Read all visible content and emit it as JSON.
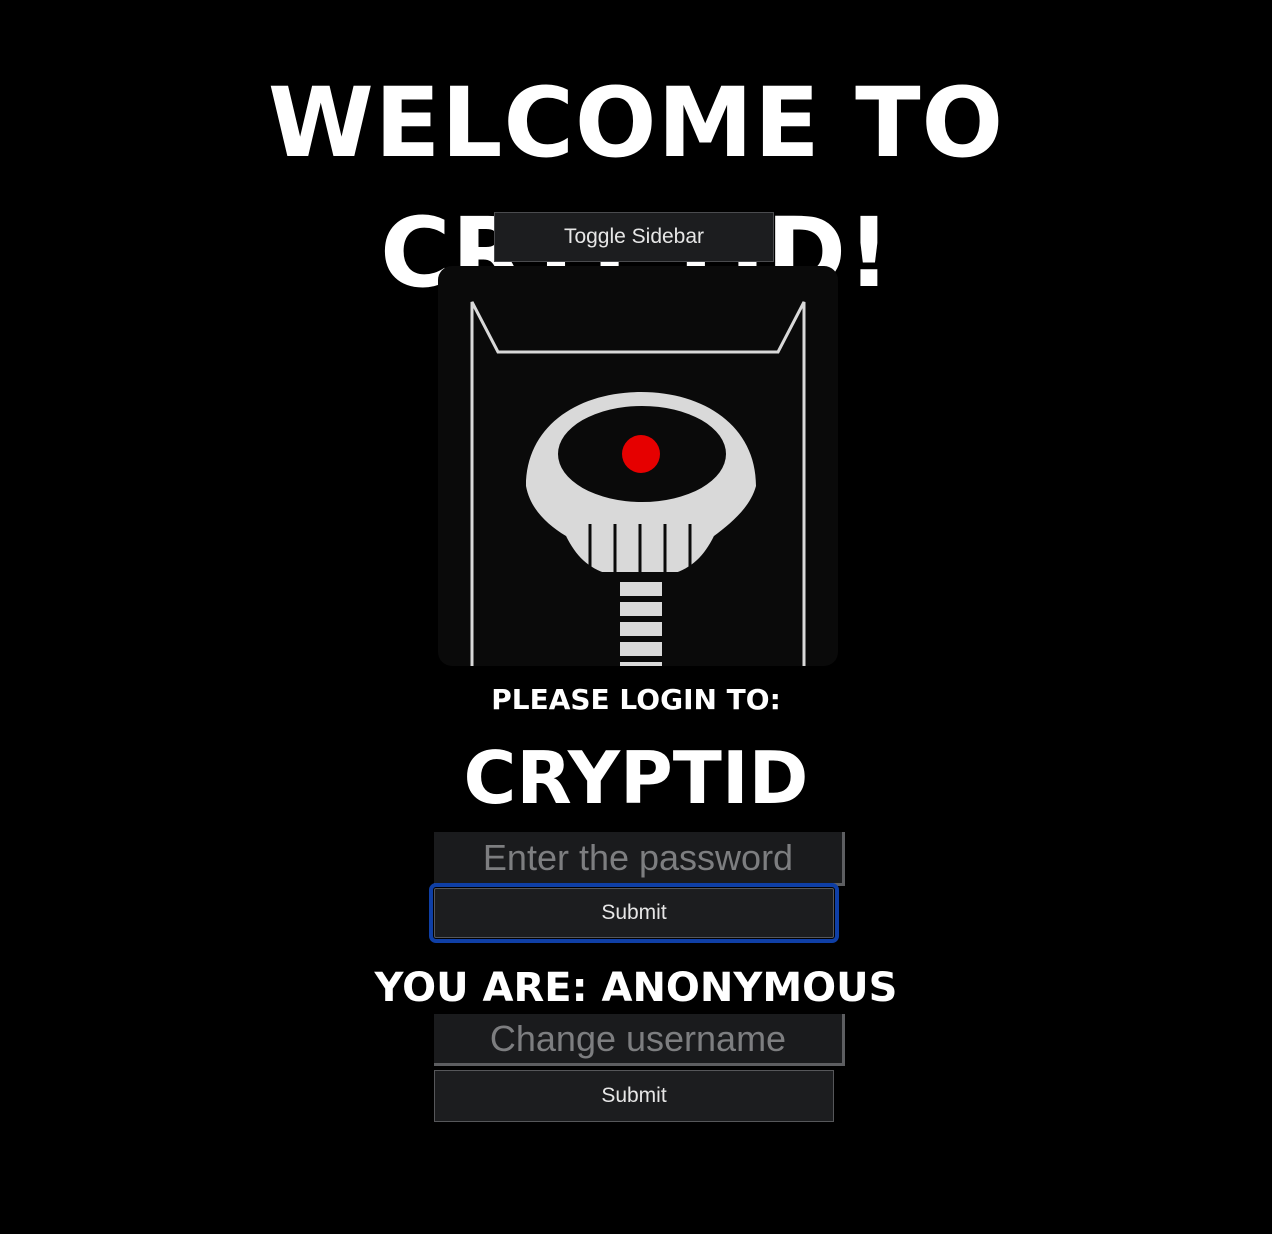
{
  "header": {
    "title": "WELCOME TO CRYPTID!"
  },
  "sidebar_toggle": {
    "label": "Toggle Sidebar"
  },
  "logo": {
    "icon": "cryptid-skull-logo",
    "colors": {
      "background": "#0a0a0a",
      "bone": "#d9d9d9",
      "eye": "#e60000"
    }
  },
  "login": {
    "prompt": "PLEASE LOGIN TO:",
    "target": "CRYPTID",
    "password_placeholder": "Enter the password",
    "password_value": "",
    "submit_label": "Submit"
  },
  "user": {
    "status": "YOU ARE: ANONYMOUS",
    "username_placeholder": "Change username",
    "username_value": "",
    "submit_label": "Submit"
  },
  "colors": {
    "page_background": "#000000",
    "focus_ring": "#0f3fa6",
    "button_background": "#1c1d1f"
  }
}
